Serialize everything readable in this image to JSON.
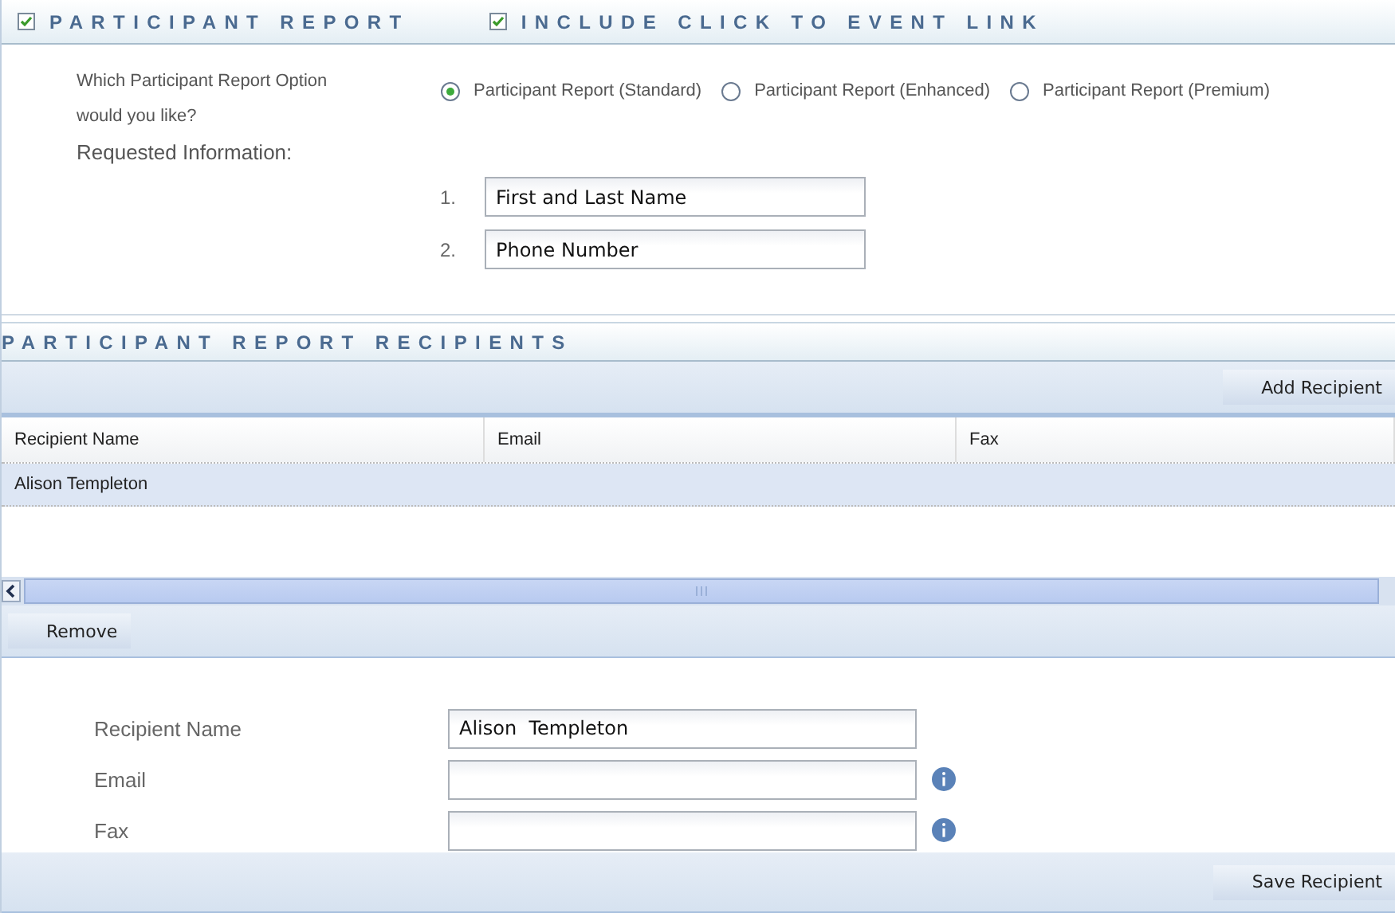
{
  "header": {
    "items": [
      {
        "label": "PARTICIPANT REPORT",
        "checked": true
      },
      {
        "label": "INCLUDE CLICK TO EVENT LINK",
        "checked": true
      }
    ]
  },
  "report_option": {
    "question": "Which Participant Report Option would you like?",
    "options": [
      {
        "label": "Participant Report (Standard)",
        "selected": true
      },
      {
        "label": "Participant Report (Enhanced)",
        "selected": false
      },
      {
        "label": "Participant Report (Premium)",
        "selected": false
      }
    ]
  },
  "requested_information": {
    "label": "Requested Information:",
    "items": [
      {
        "number": "1.",
        "value": "First and Last Name"
      },
      {
        "number": "2.",
        "value": "Phone Number"
      }
    ]
  },
  "recipients": {
    "title": "PARTICIPANT REPORT RECIPIENTS",
    "add_button": "Add Recipient",
    "table": {
      "columns": [
        "Recipient Name",
        "Email",
        "Fax"
      ],
      "rows": [
        {
          "cells": [
            "Alison Templeton",
            "",
            ""
          ],
          "selected": true
        }
      ]
    },
    "remove_button": "Remove"
  },
  "recipient_form": {
    "fields": [
      {
        "label": "Recipient Name",
        "value": "Alison  Templeton",
        "info": false
      },
      {
        "label": "Email",
        "info": true
      },
      {
        "label": "Fax",
        "info": true
      }
    ],
    "save_button": "Save Recipient"
  }
}
